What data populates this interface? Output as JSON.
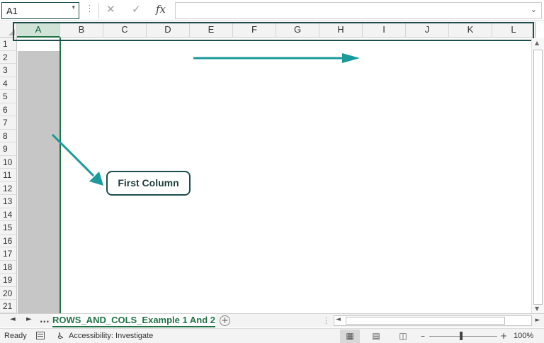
{
  "formula_bar": {
    "name_box": "A1",
    "name_box_arrow": "▾",
    "dots": "⋮",
    "cancel_glyph": "✕",
    "enter_glyph": "✓",
    "fx_label": "fx",
    "formula_value": "",
    "expand_glyph": "⌄"
  },
  "grid": {
    "columns": [
      "A",
      "B",
      "C",
      "D",
      "E",
      "F",
      "G",
      "H",
      "I",
      "J",
      "K",
      "L"
    ],
    "rows": [
      "1",
      "2",
      "3",
      "4",
      "5",
      "6",
      "7",
      "8",
      "9",
      "10",
      "11",
      "12",
      "13",
      "14",
      "15",
      "16",
      "17",
      "18",
      "19",
      "20",
      "21"
    ],
    "selected_column": "A",
    "accent_color": "#217346",
    "selection_fill": "#c6c6c6"
  },
  "annotations": {
    "callout_text": "First Column",
    "arrow_color": "#1a9a9a",
    "outline_color": "#1f4d4d"
  },
  "sheet_bar": {
    "nav_prev": "◄",
    "nav_next": "►",
    "nav_more": "...",
    "active_tab": "ROWS_AND_COLS_Example 1 And 2",
    "add_sheet": "+",
    "dots": "⋮"
  },
  "scrollbar": {
    "up": "▲",
    "down": "▼",
    "left": "◄",
    "right": "►"
  },
  "status_bar": {
    "mode": "Ready",
    "accessibility_icon": "♿",
    "accessibility": "Accessibility: Investigate",
    "view_normal_icon": "▦",
    "view_page_layout_icon": "▤",
    "view_page_break_icon": "◫",
    "zoom_minus": "–",
    "zoom_plus": "+",
    "zoom": "100%",
    "zoom_fraction": 0.47
  }
}
